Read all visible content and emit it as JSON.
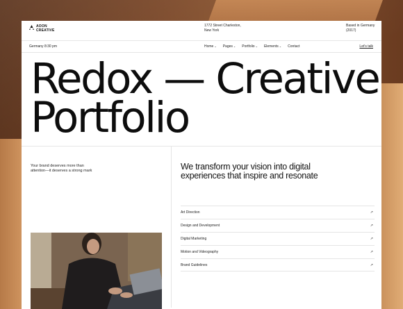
{
  "header": {
    "logo_line1": "AOON",
    "logo_line2": "CREATIVE",
    "address_line1": "1772 Street Charleston,",
    "address_line2": "New York",
    "based_line1": "Based in Germany",
    "based_line2": "(2017)"
  },
  "nav": {
    "local_time": "Germany 8:30 pm",
    "items": [
      {
        "label": "Home",
        "chevron": "⌄"
      },
      {
        "label": "Pages",
        "chevron": "⌄"
      },
      {
        "label": "Portfolio",
        "chevron": "⌄"
      },
      {
        "label": "Elements",
        "chevron": "⌄"
      },
      {
        "label": "Contact",
        "chevron": ""
      }
    ],
    "cta": "Let's talk"
  },
  "hero": {
    "title_line1": "Redox — Creative",
    "title_line2": "Portfolio"
  },
  "intro": {
    "tagline": "Your brand deserves more than attention—it deserves a strong mark",
    "headline": "We transform your vision into digital experiences that inspire and resonate"
  },
  "services": [
    {
      "label": "Art Direction",
      "arrow": "↗"
    },
    {
      "label": "Design and Development",
      "arrow": "↗"
    },
    {
      "label": "Digital Marketing",
      "arrow": "↗"
    },
    {
      "label": "Motion and Videography",
      "arrow": "↗"
    },
    {
      "label": "Brand Guidelines",
      "arrow": "↗"
    }
  ],
  "colors": {
    "text": "#0d0d0d",
    "divider": "#e5e5e5",
    "background": "#ffffff"
  }
}
